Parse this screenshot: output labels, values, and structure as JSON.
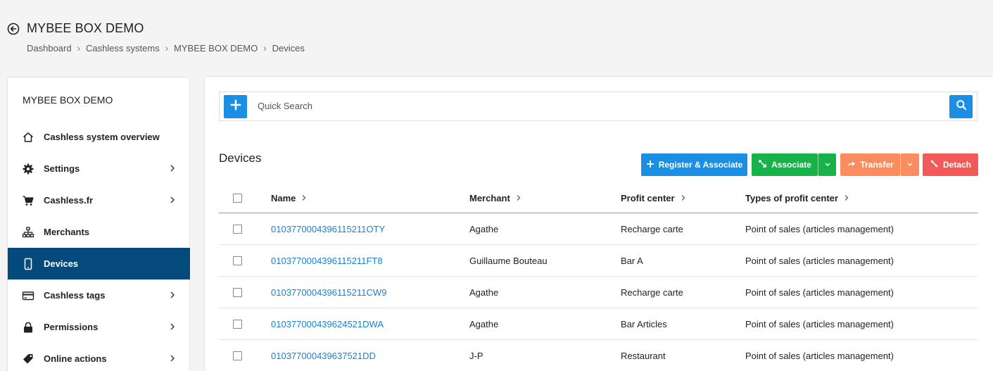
{
  "header": {
    "title": "MYBEE BOX DEMO",
    "breadcrumb": [
      "Dashboard",
      "Cashless systems",
      "MYBEE BOX DEMO",
      "Devices"
    ],
    "breadcrumb_separator": "›"
  },
  "sidebar": {
    "title": "MYBEE BOX DEMO",
    "items": [
      {
        "label": "Cashless system overview",
        "icon": "home-icon",
        "has_children": false
      },
      {
        "label": "Settings",
        "icon": "gear-icon",
        "has_children": true
      },
      {
        "label": "Cashless.fr",
        "icon": "cart-icon",
        "has_children": true
      },
      {
        "label": "Merchants",
        "icon": "org-chart-icon",
        "has_children": false
      },
      {
        "label": "Devices",
        "icon": "phone-icon",
        "has_children": false,
        "active": true
      },
      {
        "label": "Cashless tags",
        "icon": "card-icon",
        "has_children": true
      },
      {
        "label": "Permissions",
        "icon": "lock-icon",
        "has_children": true
      },
      {
        "label": "Online actions",
        "icon": "tags-icon",
        "has_children": true
      }
    ]
  },
  "search": {
    "placeholder": "Quick Search"
  },
  "devices": {
    "title": "Devices",
    "actions": {
      "register_associate": "Register & Associate",
      "associate": "Associate",
      "transfer": "Transfer",
      "detach": "Detach"
    },
    "columns": [
      "Name",
      "Merchant",
      "Profit center",
      "Types of profit center"
    ],
    "rows": [
      {
        "name": "0103770004396115211OTY",
        "merchant": "Agathe",
        "profit_center": "Recharge carte",
        "type": "Point of sales (articles management)"
      },
      {
        "name": "0103770004396115211FT8",
        "merchant": "Guillaume Bouteau",
        "profit_center": "Bar A",
        "type": "Point of sales (articles management)"
      },
      {
        "name": "0103770004396115211CW9",
        "merchant": "Agathe",
        "profit_center": "Recharge carte",
        "type": "Point of sales (articles management)"
      },
      {
        "name": "010377000439624521DWA",
        "merchant": "Agathe",
        "profit_center": "Bar Articles",
        "type": "Point of sales (articles management)"
      },
      {
        "name": "010377000439637521DD",
        "merchant": "J-P",
        "profit_center": "Restaurant",
        "type": "Point of sales (articles management)"
      }
    ]
  },
  "colors": {
    "primary": "#1a8fe3",
    "active_nav": "#044a7c",
    "green": "#17b24a",
    "orange": "#fb8c60",
    "red": "#f25a5a",
    "link": "#1a80d4"
  }
}
